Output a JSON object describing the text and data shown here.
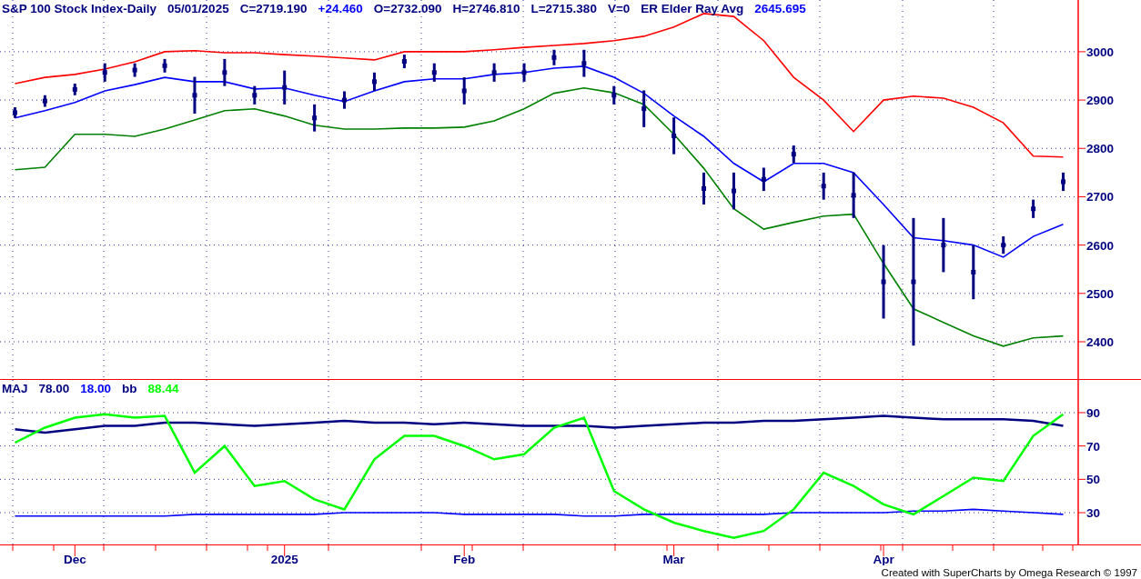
{
  "header": [
    {
      "text": "S&P 100 Stock Index-Daily",
      "color": "#000080"
    },
    {
      "text": "05/01/2025",
      "color": "#000080"
    },
    {
      "text": "C=2719.190",
      "color": "#000080"
    },
    {
      "text": "+24.460",
      "color": "#0000ff"
    },
    {
      "text": "O=2732.090",
      "color": "#000080"
    },
    {
      "text": "H=2746.810",
      "color": "#000080"
    },
    {
      "text": "L=2715.380",
      "color": "#000080"
    },
    {
      "text": "V=0",
      "color": "#000080"
    },
    {
      "text": "ER Elder Ray Avg",
      "color": "#000080"
    },
    {
      "text": "2645.695",
      "color": "#0000ff"
    }
  ],
  "price_panel": {
    "chart_data": {
      "type": "line",
      "grid": true,
      "ylim": [
        2321,
        3107
      ],
      "yticks": [
        2400,
        2500,
        2600,
        2700,
        2800,
        2900,
        3000
      ],
      "series": [
        {
          "color": "#ff0000",
          "values": [
            2934,
            2947,
            2953,
            2964,
            2979,
            3000,
            3002,
            2998,
            2998,
            2994,
            2991,
            2987,
            2983,
            3000,
            3000,
            3000,
            3004,
            3009,
            3013,
            3017,
            3023,
            3032,
            3051,
            3079,
            3073,
            3023,
            2947,
            2900,
            2835,
            2900,
            2908,
            2904,
            2885,
            2853,
            2784,
            2782
          ]
        },
        {
          "color": "#0000ff",
          "values": [
            2863,
            2878,
            2895,
            2919,
            2932,
            2947,
            2938,
            2938,
            2923,
            2925,
            2910,
            2897,
            2919,
            2938,
            2944,
            2944,
            2953,
            2957,
            2966,
            2970,
            2947,
            2914,
            2867,
            2825,
            2769,
            2731,
            2769,
            2769,
            2750,
            2684,
            2615,
            2609,
            2600,
            2575,
            2618,
            2643
          ]
        },
        {
          "color": "#008000",
          "values": [
            2756,
            2761,
            2829,
            2829,
            2825,
            2840,
            2859,
            2878,
            2882,
            2867,
            2848,
            2840,
            2840,
            2842,
            2842,
            2844,
            2857,
            2882,
            2914,
            2925,
            2915,
            2891,
            2829,
            2759,
            2675,
            2633,
            2647,
            2660,
            2664,
            2562,
            2468,
            2440,
            2412,
            2391,
            2408,
            2412
          ]
        },
        {
          "type": "scatter",
          "color": "#000080",
          "values": [
            2874,
            2898,
            2922,
            2957,
            2962,
            2971,
            2910,
            2957,
            2910,
            2926,
            2863,
            2900,
            2938,
            2980,
            2957,
            2919,
            2957,
            2957,
            2988,
            2976,
            2910,
            2882,
            2826,
            2717,
            2712,
            2736,
            2788,
            2722,
            2703,
            2524,
            2524,
            2600,
            2544,
            2600,
            2675,
            2731
          ],
          "errors": [
            11,
            12,
            12,
            19,
            14,
            14,
            38,
            28,
            19,
            35,
            28,
            18,
            19,
            14,
            19,
            28,
            19,
            19,
            16,
            28,
            19,
            38,
            38,
            33,
            38,
            24,
            18,
            28,
            47,
            76,
            132,
            56,
            56,
            18,
            19,
            19
          ]
        }
      ]
    }
  },
  "oscillator_panel": {
    "legend": [
      {
        "text": "MAJ",
        "color": "#000080"
      },
      {
        "text": "78.00",
        "color": "#000080"
      },
      {
        "text": "18.00",
        "color": "#0000ff"
      },
      {
        "text": "bb",
        "color": "#000080"
      },
      {
        "text": "88.44",
        "color": "#00ff00"
      }
    ],
    "chart_data": {
      "type": "line",
      "grid": true,
      "ylim": [
        10.4,
        109.6
      ],
      "yticks": [
        30,
        50,
        70,
        90
      ],
      "categories": [
        null,
        null,
        "Dec",
        null,
        null,
        null,
        null,
        null,
        null,
        "2025",
        null,
        null,
        null,
        null,
        null,
        "Feb",
        null,
        null,
        null,
        null,
        null,
        null,
        "Mar",
        null,
        null,
        null,
        null,
        null,
        null,
        "Apr",
        null,
        null,
        null,
        null,
        null,
        null
      ],
      "series": [
        {
          "color": "#000080",
          "values": [
            80,
            78,
            80,
            82,
            82,
            84,
            84,
            83,
            82,
            83,
            84,
            85,
            84,
            84,
            83,
            84,
            83,
            82,
            82,
            82,
            81,
            82,
            83,
            84,
            84,
            85,
            85,
            86,
            87,
            88,
            87,
            86,
            86,
            86,
            85,
            82
          ]
        },
        {
          "color": "#0000ff",
          "values": [
            28,
            28,
            28,
            28,
            28,
            28,
            29,
            29,
            29,
            29,
            29,
            30,
            30,
            30,
            30,
            29,
            29,
            29,
            29,
            28,
            28,
            29,
            29,
            29,
            29,
            29,
            30,
            30,
            30,
            30,
            31,
            31,
            32,
            31,
            30,
            29
          ]
        },
        {
          "color": "#00ff00",
          "values": [
            72,
            81,
            87,
            89,
            87,
            88,
            54,
            70,
            46,
            49,
            38,
            32,
            62,
            76,
            76,
            70,
            62,
            65,
            81,
            87,
            43,
            32,
            24,
            19,
            15,
            19,
            32,
            54,
            46,
            35,
            29,
            40,
            51,
            49,
            76,
            89
          ]
        }
      ]
    }
  },
  "credit": "Created with SuperCharts by Omega Research © 1997"
}
